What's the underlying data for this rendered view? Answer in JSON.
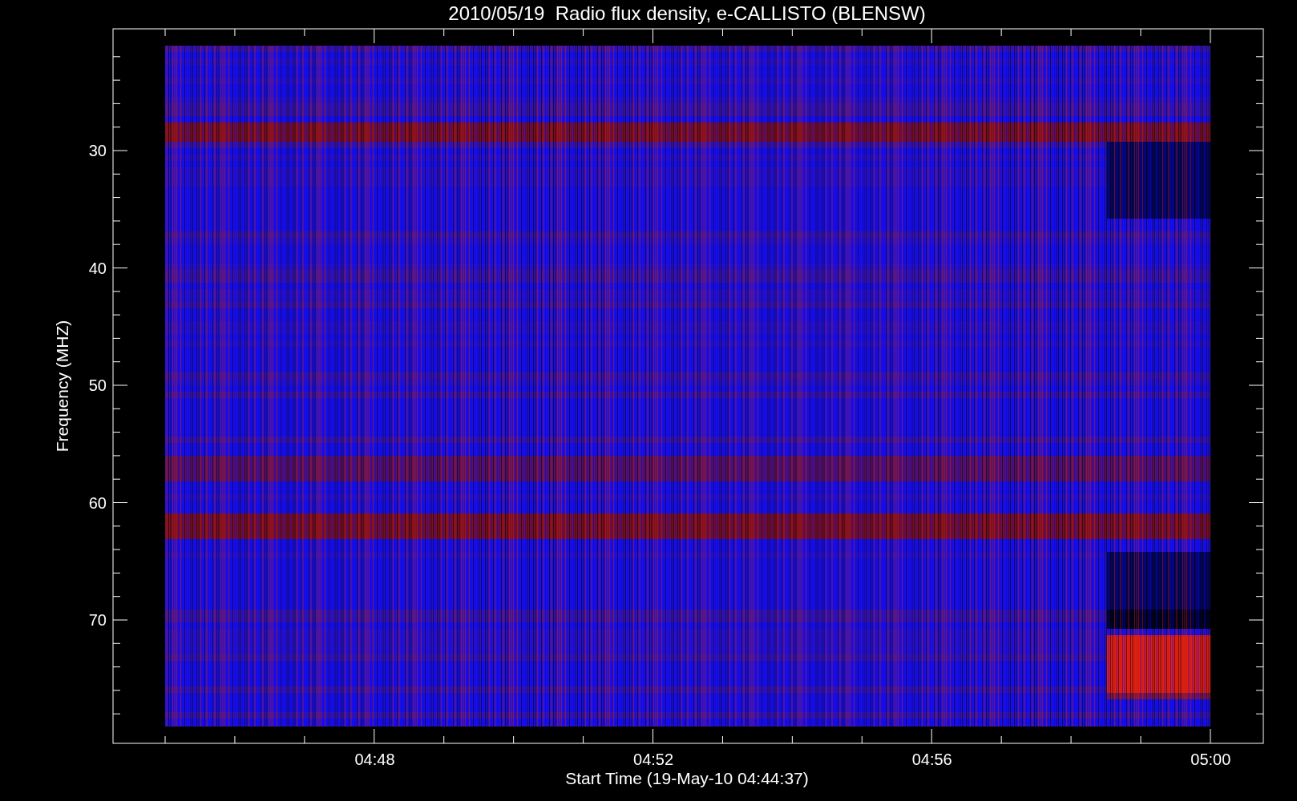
{
  "title": "2010/05/19  Radio flux density, e-CALLISTO (BLENSW)",
  "ylabel": "Frequency (MHZ)",
  "xlabel": "Start Time (19-May-10 04:44:37)",
  "yticks": [
    "30",
    "40",
    "50",
    "60",
    "70"
  ],
  "xticks": [
    "04:48",
    "04:52",
    "04:56",
    "05:00"
  ]
}
